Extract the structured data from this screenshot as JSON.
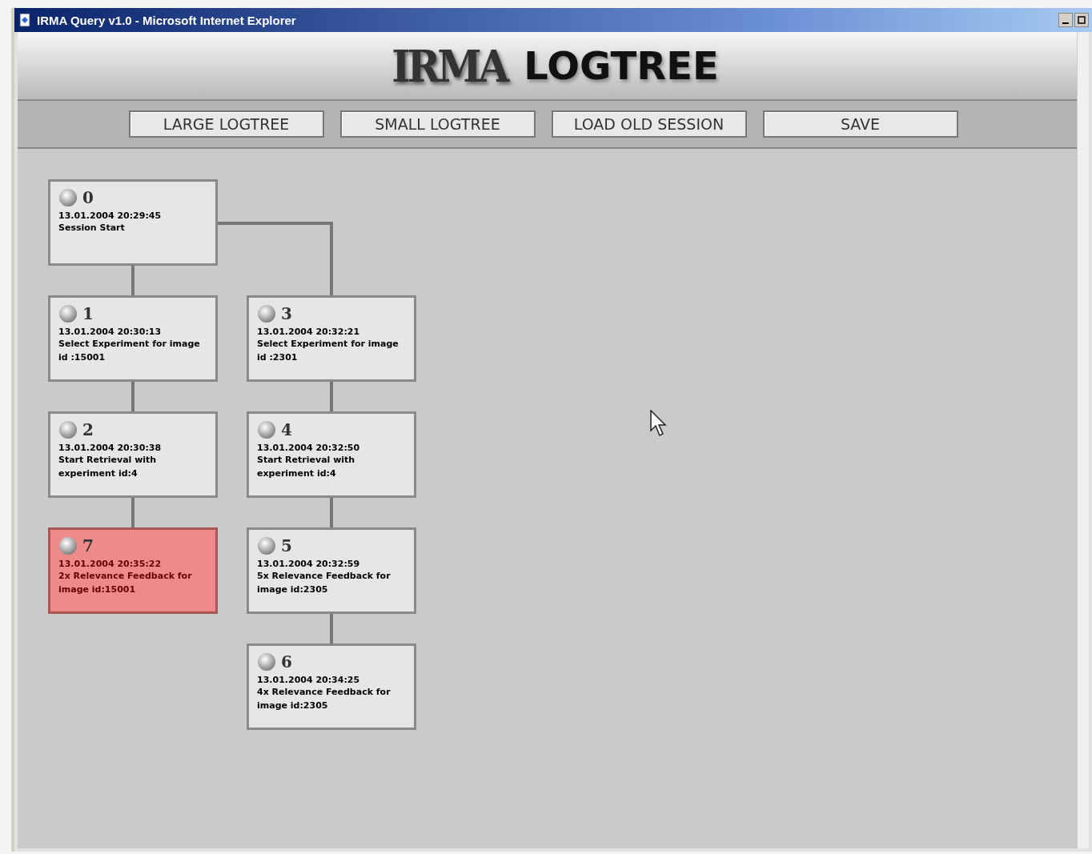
{
  "window": {
    "title": "IRMA Query v1.0 - Microsoft Internet Explorer"
  },
  "header": {
    "logo": "IRMA",
    "title": "LOGTREE"
  },
  "toolbar": [
    "LARGE LOGTREE",
    "SMALL LOGTREE",
    "LOAD OLD SESSION",
    "SAVE"
  ],
  "tree": [
    {
      "id": "0",
      "time": "13.01.2004 20:29:45",
      "action": "Session Start",
      "selected": false,
      "children": [
        {
          "id": "1",
          "time": "13.01.2004 20:30:13",
          "action": "Select Experiment for image id :15001",
          "selected": false,
          "children": [
            {
              "id": "2",
              "time": "13.01.2004 20:30:38",
              "action": "Start Retrieval with experiment id:4",
              "selected": false,
              "children": [
                {
                  "id": "7",
                  "time": "13.01.2004 20:35:22",
                  "action": "2x Relevance Feedback for image id:15001",
                  "selected": true
                }
              ]
            }
          ]
        },
        {
          "id": "3",
          "time": "13.01.2004 20:32:21",
          "action": "Select Experiment for image id :2301",
          "selected": false,
          "children": [
            {
              "id": "4",
              "time": "13.01.2004 20:32:50",
              "action": "Start Retrieval with experiment id:4",
              "selected": false,
              "children": [
                {
                  "id": "5",
                  "time": "13.01.2004 20:32:59",
                  "action": "5x Relevance Feedback for image id:2305",
                  "selected": false,
                  "children": [
                    {
                      "id": "6",
                      "time": "13.01.2004 20:34:25",
                      "action": "4x Relevance Feedback for image id:2305",
                      "selected": false
                    }
                  ]
                }
              ]
            }
          ]
        }
      ]
    }
  ]
}
